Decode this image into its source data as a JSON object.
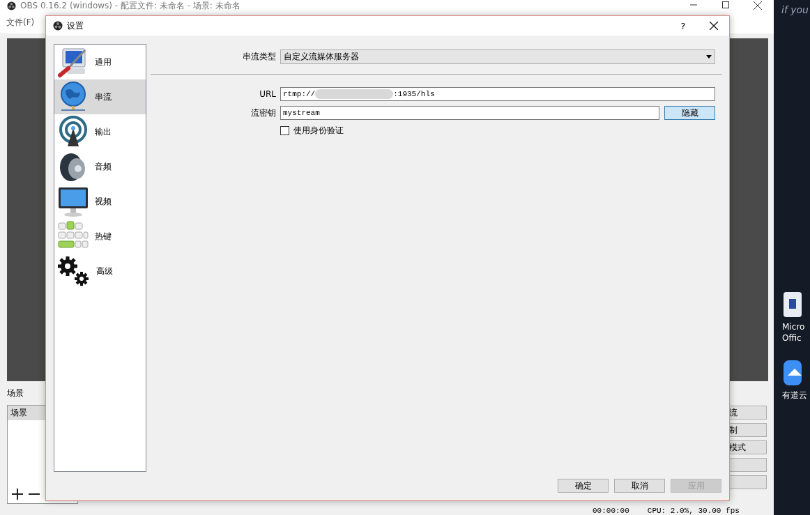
{
  "main_window": {
    "title": "OBS 0.16.2 (windows) - 配置文件: 未命名 - 场景: 未命名",
    "menu": [
      "文件(F)"
    ],
    "scenes_label": "场景",
    "scene_list": {
      "items": [
        {
          "label": "场景",
          "selected": true
        }
      ]
    },
    "side_buttons": [
      {
        "kind": "labeled",
        "label": "流"
      },
      {
        "kind": "labeled",
        "label": "制"
      },
      {
        "kind": "labeled",
        "label": "模式"
      },
      {
        "kind": "blank"
      },
      {
        "kind": "blank"
      }
    ],
    "status_bar": {
      "time": "00:00:00",
      "cpu": "CPU: 2.0%, 30.00 fps"
    }
  },
  "desktop": {
    "banner_text": "if you",
    "icons": [
      {
        "label": "Micro Offic",
        "kind": "office"
      },
      {
        "label": "有道云",
        "kind": "cloud"
      }
    ]
  },
  "dialog": {
    "title": "设置",
    "help": "?",
    "sidebar": {
      "items": [
        {
          "label": "通用",
          "kind": "general",
          "selected": false
        },
        {
          "label": "串流",
          "kind": "stream",
          "selected": true
        },
        {
          "label": "输出",
          "kind": "output",
          "selected": false
        },
        {
          "label": "音频",
          "kind": "audio",
          "selected": false
        },
        {
          "label": "视频",
          "kind": "video",
          "selected": false
        },
        {
          "label": "热键",
          "kind": "hotkeys",
          "selected": false
        },
        {
          "label": "高级",
          "kind": "advanced",
          "selected": false
        }
      ]
    },
    "stream_type": {
      "label": "串流类型",
      "value": "自定义流媒体服务器"
    },
    "url": {
      "label": "URL",
      "value_start": "rtmp://",
      "value_end": ":1935/hls",
      "redacted": true
    },
    "stream_key": {
      "label": "流密钥",
      "value": "mystream",
      "button": "隐藏"
    },
    "auth": {
      "label": "使用身份验证",
      "checked": false
    },
    "buttons": [
      {
        "label": "确定",
        "disabled": false
      },
      {
        "label": "取消",
        "disabled": false
      },
      {
        "label": "应用",
        "disabled": true
      }
    ]
  }
}
